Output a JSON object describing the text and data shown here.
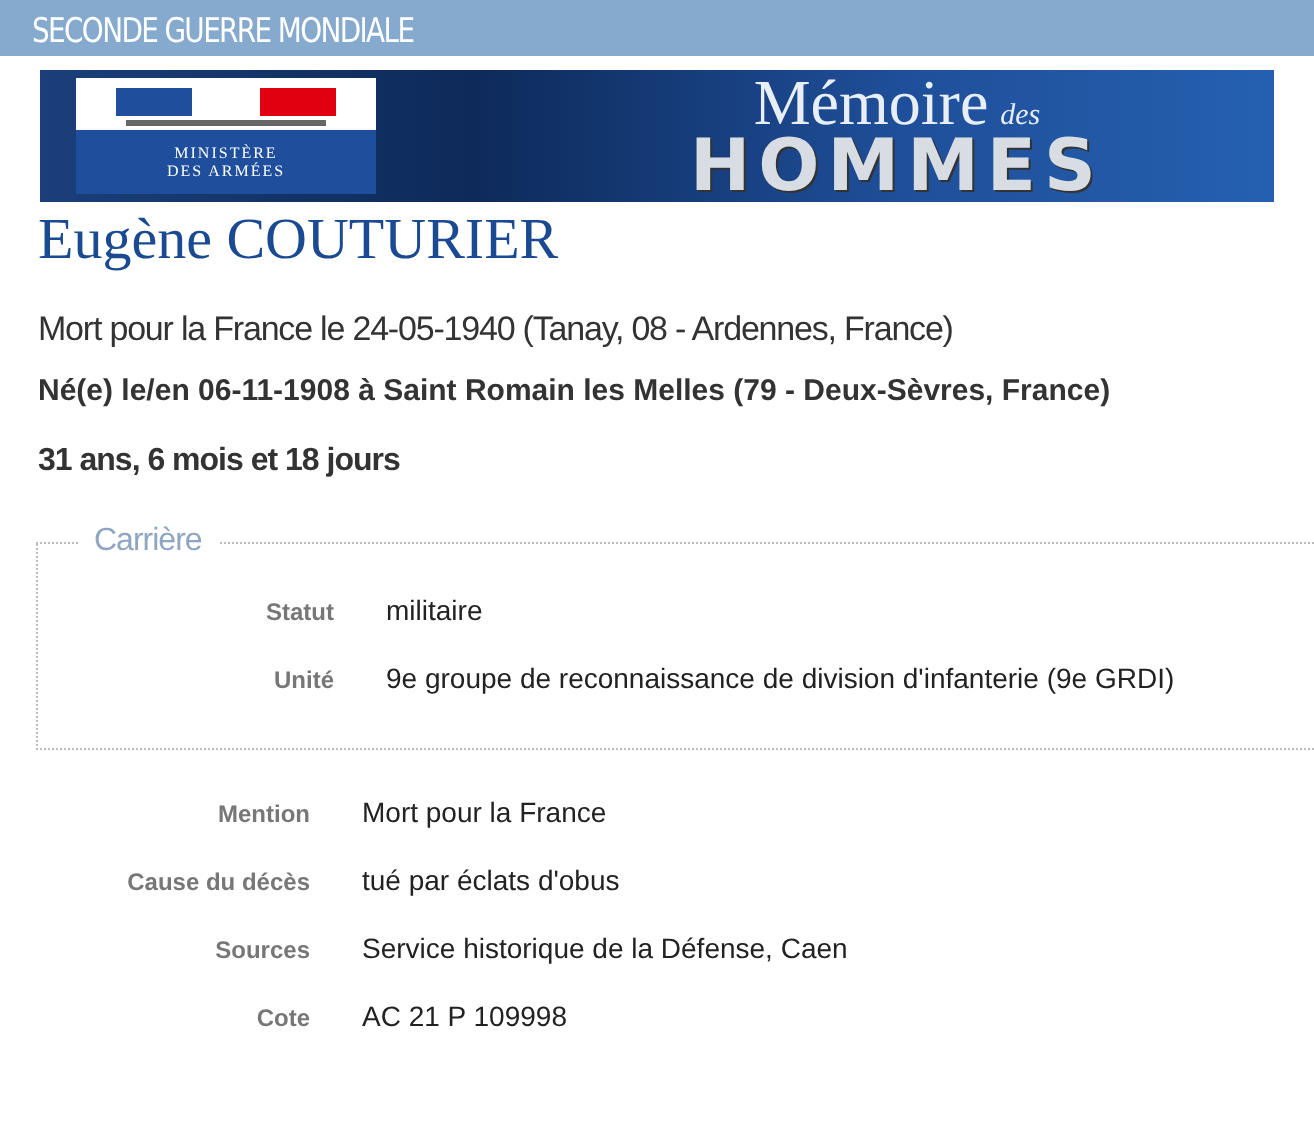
{
  "header": {
    "title": "SECONDE GUERRE MONDIALE"
  },
  "banner": {
    "ministry": [
      "MINISTÈRE",
      "DES ARMÉES"
    ],
    "title": "Mémoire",
    "title_small": "des",
    "title_big": "HOMMES"
  },
  "person": {
    "name": "Eugène COUTURIER",
    "death": "Mort pour la France le 24-05-1940 (Tanay, 08 - Ardennes, France)",
    "birth": "Né(e) le/en 06-11-1908 à Saint Romain les Melles (79 - Deux-Sèvres, France)",
    "age": "31 ans, 6 mois et 18 jours"
  },
  "career": {
    "legend": "Carrière",
    "rows": [
      {
        "label": "Statut",
        "value": "militaire"
      },
      {
        "label": "Unité",
        "value": "9e groupe de reconnaissance de division d'infanterie (9e GRDI)"
      }
    ]
  },
  "details": [
    {
      "label": "Mention",
      "value": "Mort pour la France"
    },
    {
      "label": "Cause du décès",
      "value": "tué par éclats d'obus"
    },
    {
      "label": "Sources",
      "value": "Service historique de la Défense, Caen"
    },
    {
      "label": "Cote",
      "value": "AC 21 P 109998"
    }
  ]
}
